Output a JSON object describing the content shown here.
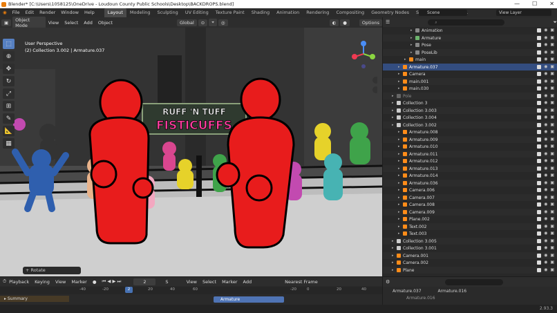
{
  "titlebar": {
    "title": "Blender* [C:\\Users\\1058125\\OneDrive - Loudoun County Public Schools\\Desktop\\BACKDROPS.blend]",
    "minimize": "—",
    "maximize": "☐",
    "close": "✕"
  },
  "menus": [
    "File",
    "Edit",
    "Render",
    "Window",
    "Help"
  ],
  "workspaces": [
    "Layout",
    "Modeling",
    "Sculpting",
    "UV Editing",
    "Texture Paint",
    "Shading",
    "Animation",
    "Rendering",
    "Compositing",
    "Geometry Nodes",
    "Scripting",
    "Layout.001"
  ],
  "scene": "Scene",
  "view_layer": "View Layer",
  "viewport_header": {
    "mode": "Object Mode",
    "menus": [
      "View",
      "Select",
      "Add",
      "Object"
    ],
    "orientation": "Global",
    "options": "Options"
  },
  "viewport_info": {
    "view": "User Perspective",
    "collection": "(2) Collection 3.002 | Armature.037"
  },
  "banner": {
    "line1": "RUFF 'N TUFF",
    "line2": "FISTICUFFS"
  },
  "last_op": "Rotate",
  "outliner": {
    "rows": [
      {
        "name": "Animation",
        "indent": 4,
        "icon": "#888",
        "extra": "",
        "state": ""
      },
      {
        "name": "Armature",
        "indent": 4,
        "icon": "#6db56d",
        "extra": "",
        "state": ""
      },
      {
        "name": "Pose",
        "indent": 4,
        "icon": "#888",
        "extra": "",
        "state": ""
      },
      {
        "name": "PoseLib",
        "indent": 4,
        "icon": "#888",
        "extra": "",
        "state": ""
      },
      {
        "name": "main",
        "indent": 3,
        "icon": "#ff8c19",
        "extra": "",
        "state": ""
      },
      {
        "name": "Armature.037",
        "indent": 2,
        "icon": "#ff8c19",
        "extra": "",
        "state": "sel"
      },
      {
        "name": "Camera",
        "indent": 2,
        "icon": "#ff8c19",
        "extra": "",
        "state": ""
      },
      {
        "name": "main.001",
        "indent": 2,
        "icon": "#ff8c19",
        "extra": "",
        "state": ""
      },
      {
        "name": "main.030",
        "indent": 2,
        "icon": "#ff8c19",
        "extra": "",
        "state": ""
      },
      {
        "name": "Pole",
        "indent": 1,
        "icon": "#666",
        "extra": "",
        "state": "dim"
      },
      {
        "name": "Collection 3",
        "indent": 1,
        "icon": "#cccccc",
        "extra": "",
        "state": ""
      },
      {
        "name": "Collection 3.003",
        "indent": 1,
        "icon": "#cccccc",
        "extra": "",
        "state": ""
      },
      {
        "name": "Collection 3.004",
        "indent": 1,
        "icon": "#cccccc",
        "extra": "",
        "state": ""
      },
      {
        "name": "Collection 3.002",
        "indent": 1,
        "icon": "#cccccc",
        "extra": "",
        "state": ""
      },
      {
        "name": "Armature.008",
        "indent": 2,
        "icon": "#ff8c19",
        "extra": "",
        "state": ""
      },
      {
        "name": "Armature.009",
        "indent": 2,
        "icon": "#ff8c19",
        "extra": "",
        "state": ""
      },
      {
        "name": "Armature.010",
        "indent": 2,
        "icon": "#ff8c19",
        "extra": "",
        "state": ""
      },
      {
        "name": "Armature.011",
        "indent": 2,
        "icon": "#ff8c19",
        "extra": "",
        "state": ""
      },
      {
        "name": "Armature.012",
        "indent": 2,
        "icon": "#ff8c19",
        "extra": "",
        "state": ""
      },
      {
        "name": "Armature.013",
        "indent": 2,
        "icon": "#ff8c19",
        "extra": "",
        "state": ""
      },
      {
        "name": "Armature.014",
        "indent": 2,
        "icon": "#ff8c19",
        "extra": "",
        "state": ""
      },
      {
        "name": "Armature.036",
        "indent": 2,
        "icon": "#ff8c19",
        "extra": "",
        "state": ""
      },
      {
        "name": "Camera.006",
        "indent": 2,
        "icon": "#ff8c19",
        "extra": "",
        "state": ""
      },
      {
        "name": "Camera.007",
        "indent": 2,
        "icon": "#ff8c19",
        "extra": "",
        "state": ""
      },
      {
        "name": "Camera.008",
        "indent": 2,
        "icon": "#ff8c19",
        "extra": "",
        "state": ""
      },
      {
        "name": "Camera.009",
        "indent": 2,
        "icon": "#ff8c19",
        "extra": "",
        "state": ""
      },
      {
        "name": "Plane.002",
        "indent": 2,
        "icon": "#ff8c19",
        "extra": "",
        "state": ""
      },
      {
        "name": "Text.002",
        "indent": 2,
        "icon": "#ff8c19",
        "extra": "",
        "state": ""
      },
      {
        "name": "Text.003",
        "indent": 2,
        "icon": "#ff8c19",
        "extra": "",
        "state": ""
      },
      {
        "name": "Collection 3.005",
        "indent": 1,
        "icon": "#cccccc",
        "extra": "",
        "state": ""
      },
      {
        "name": "Collection 3.001",
        "indent": 1,
        "icon": "#cccccc",
        "extra": "",
        "state": ""
      },
      {
        "name": "Camera.001",
        "indent": 1,
        "icon": "#ff8c19",
        "extra": "",
        "state": ""
      },
      {
        "name": "Camera.002",
        "indent": 1,
        "icon": "#ff8c19",
        "extra": "",
        "state": ""
      },
      {
        "name": "Plane",
        "indent": 1,
        "icon": "#ff8c19",
        "extra": "",
        "state": ""
      }
    ]
  },
  "timeline": {
    "menus": [
      "Playback",
      "Keying",
      "View",
      "Marker"
    ],
    "current_frame": "2",
    "start_label": "S",
    "dope_menus": [
      "View",
      "Select",
      "Marker",
      "Add"
    ],
    "interp": "Nearest Frame",
    "ruler": [
      "-40",
      "-20",
      "0",
      "20",
      "40",
      "60"
    ],
    "ruler2": [
      "-20",
      "0",
      "2",
      "20",
      "40"
    ],
    "summary": "Summary",
    "strip": "Armature"
  },
  "props": {
    "obj1": "Armature.037",
    "obj2": "Armature.016",
    "obj3": "Armature.016"
  },
  "status": {
    "version": "2.93.3"
  }
}
